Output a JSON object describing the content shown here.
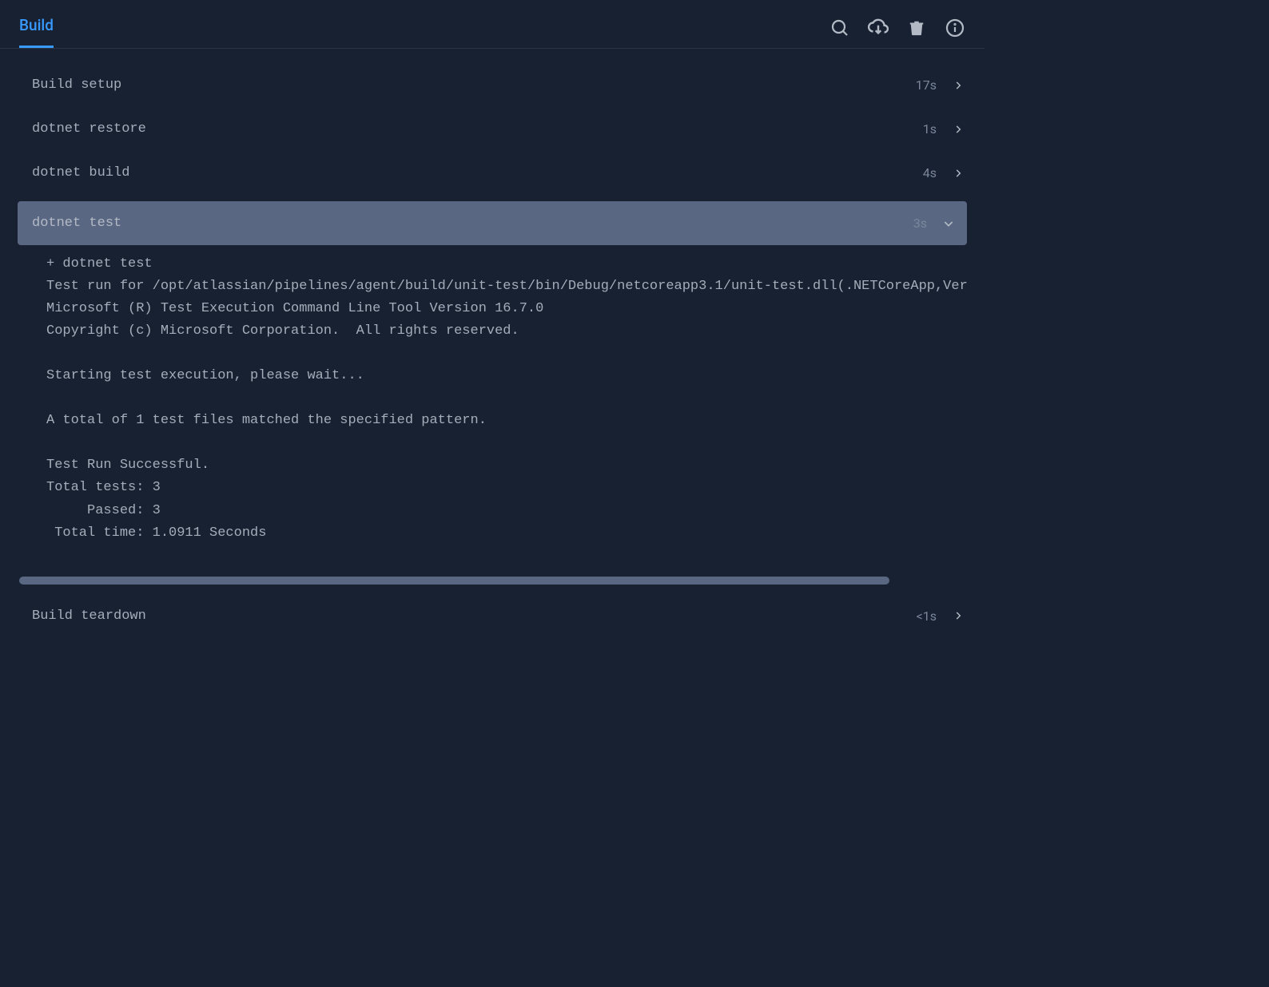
{
  "header": {
    "tab_label": "Build"
  },
  "steps": [
    {
      "name": "Build setup",
      "duration": "17s",
      "expanded": false
    },
    {
      "name": "dotnet restore",
      "duration": "1s",
      "expanded": false
    },
    {
      "name": "dotnet build",
      "duration": "4s",
      "expanded": false
    },
    {
      "name": "dotnet test",
      "duration": "3s",
      "expanded": true,
      "log": "+ dotnet test\nTest run for /opt/atlassian/pipelines/agent/build/unit-test/bin/Debug/netcoreapp3.1/unit-test.dll(.NETCoreApp,Ver\nMicrosoft (R) Test Execution Command Line Tool Version 16.7.0\nCopyright (c) Microsoft Corporation.  All rights reserved.\n\nStarting test execution, please wait...\n\nA total of 1 test files matched the specified pattern.\n\nTest Run Successful.\nTotal tests: 3\n     Passed: 3\n Total time: 1.0911 Seconds"
    },
    {
      "name": "Build teardown",
      "duration": "<1s",
      "expanded": false
    }
  ]
}
